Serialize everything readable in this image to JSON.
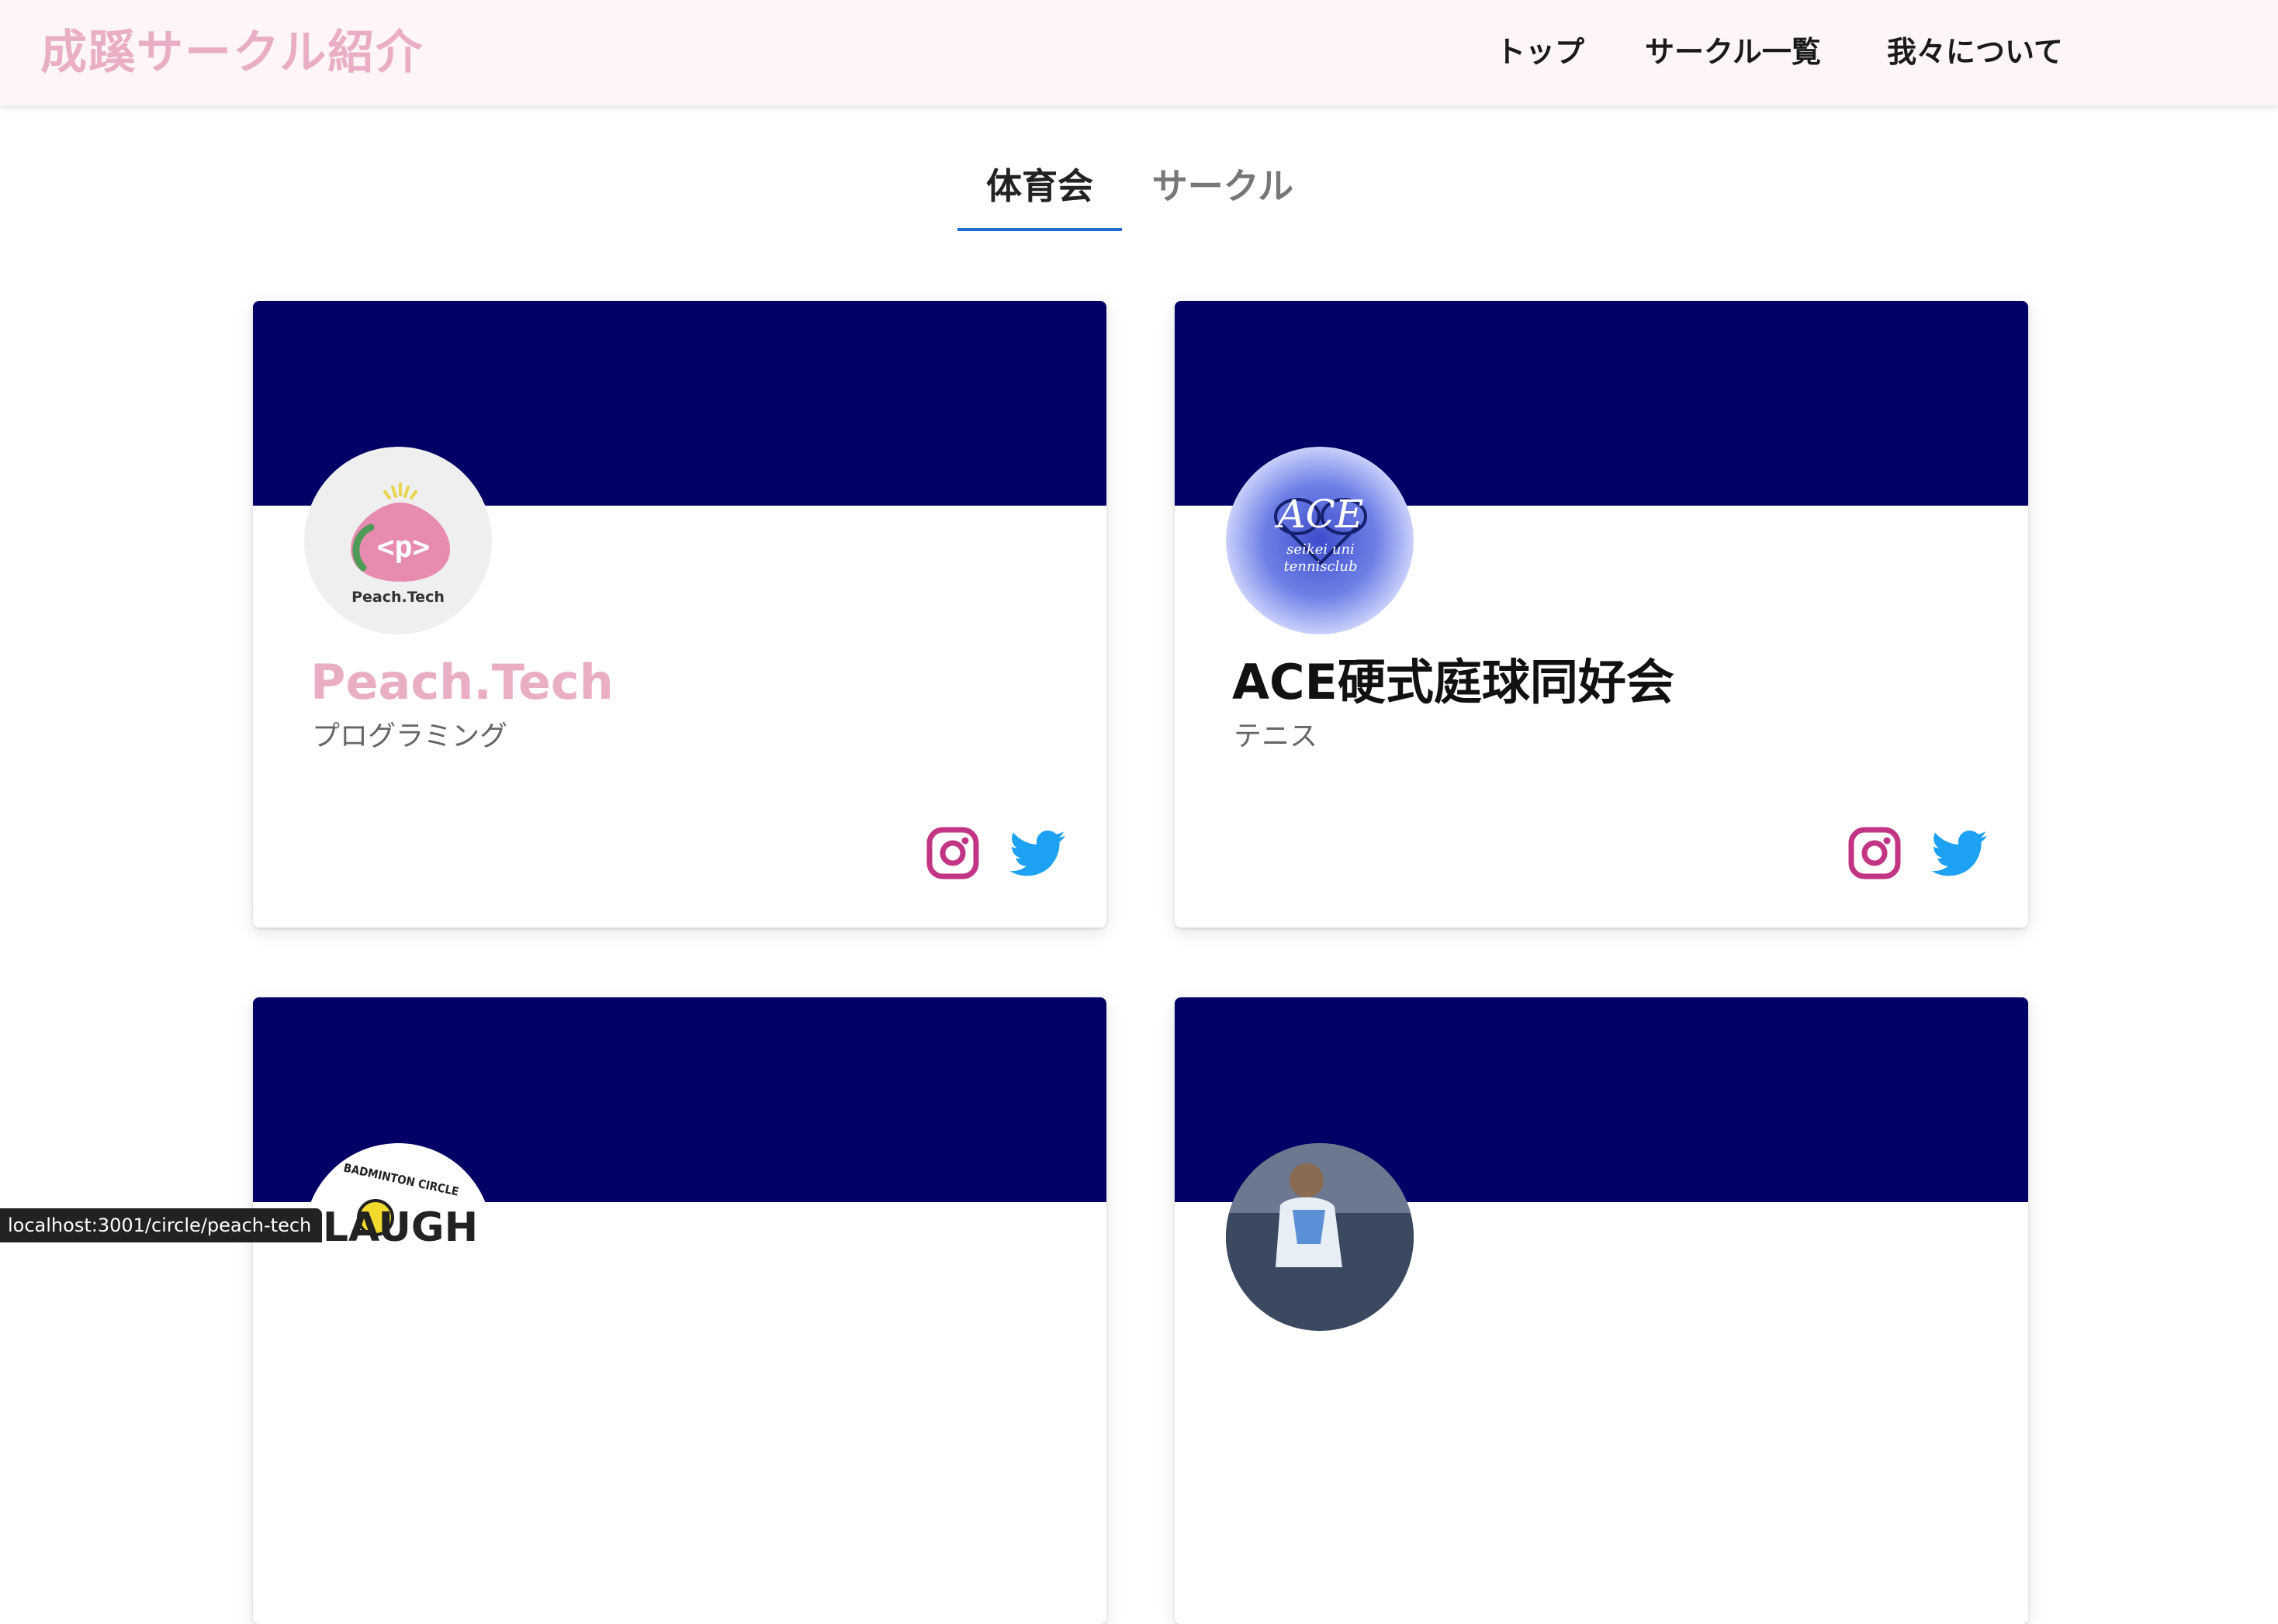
{
  "header": {
    "brand": "成蹊サークル紹介",
    "nav": [
      "トップ",
      "サークル一覧",
      "我々について"
    ]
  },
  "tabs": [
    {
      "label": "体育会",
      "active": true
    },
    {
      "label": "サークル",
      "active": false
    }
  ],
  "cards": [
    {
      "name": "Peach.Tech",
      "category": "プログラミング",
      "logo_text": "Peach.Tech",
      "logo_tag": "<p>",
      "name_color": "#eaaec4"
    },
    {
      "name": "ACE硬式庭球同好会",
      "category": "テニス",
      "logo_title": "ACE",
      "logo_sub1": "seikei uni",
      "logo_sub2": "tennisclub",
      "name_color": "#111111"
    },
    {
      "logo_text_top": "BADMINTON CIRCLE",
      "logo_text": "LAUGH"
    },
    {}
  ],
  "icons": {
    "instagram": "instagram-icon",
    "twitter": "twitter-icon"
  },
  "colors": {
    "banner": "#000066",
    "brand": "#eaaec4",
    "instagram": "#c13584",
    "twitter": "#1da1f2",
    "tab_indicator": "#1f6fd6"
  },
  "status_bar": {
    "url": "localhost:3001/circle/peach-tech"
  }
}
